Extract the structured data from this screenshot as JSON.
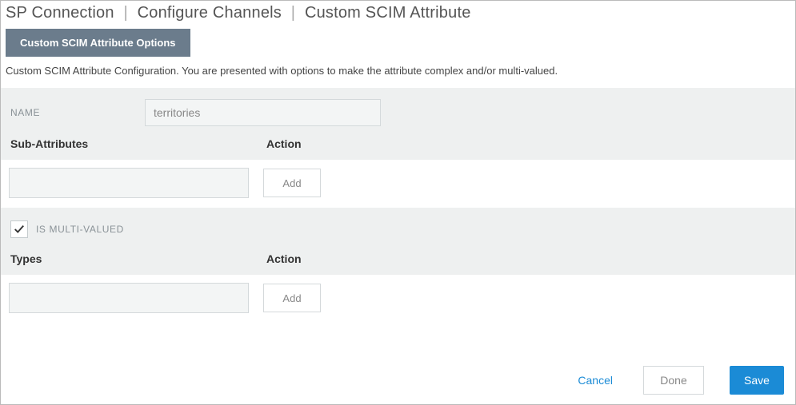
{
  "breadcrumb": {
    "a": "SP Connection",
    "b": "Configure Channels",
    "c": "Custom SCIM Attribute"
  },
  "tab": {
    "label": "Custom SCIM Attribute Options"
  },
  "description": "Custom SCIM Attribute Configuration. You are presented with options to make the attribute complex and/or multi-valued.",
  "form": {
    "name_label": "NAME",
    "name_value": "territories",
    "subattr_header": "Sub-Attributes",
    "action_header": "Action",
    "add_label": "Add",
    "multi_label": "IS MULTI-VALUED",
    "multi_checked": true,
    "types_header": "Types"
  },
  "footer": {
    "cancel": "Cancel",
    "done": "Done",
    "save": "Save"
  }
}
